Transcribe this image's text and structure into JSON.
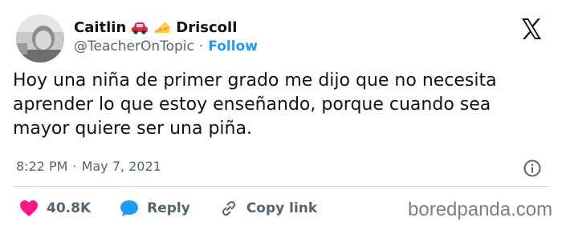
{
  "author": {
    "name_first": "Caitlin",
    "name_last": "Driscoll",
    "emoji_1": "car-emoji",
    "emoji_2": "cheese-emoji",
    "handle": "@TeacherOnTopic",
    "separator": "·",
    "follow_label": "Follow"
  },
  "tweet": {
    "text": "Hoy una niña de primer grado me dijo que no necesita aprender lo que estoy enseñando, porque cuando sea mayor quiere ser una piña.",
    "time": "8:22 PM",
    "separator": "·",
    "date": "May 7, 2021"
  },
  "actions": {
    "likes": "40.8K",
    "reply_label": "Reply",
    "copy_link_label": "Copy link"
  },
  "icons": {
    "platform": "x-logo-icon",
    "info": "info-icon",
    "like": "heart-icon",
    "reply": "reply-bubble-icon",
    "copy_link": "link-icon"
  },
  "colors": {
    "accent": "#1d9bf0",
    "like": "#f91880",
    "text": "#0f1419",
    "muted": "#536471"
  },
  "watermark": "boredpanda.com"
}
